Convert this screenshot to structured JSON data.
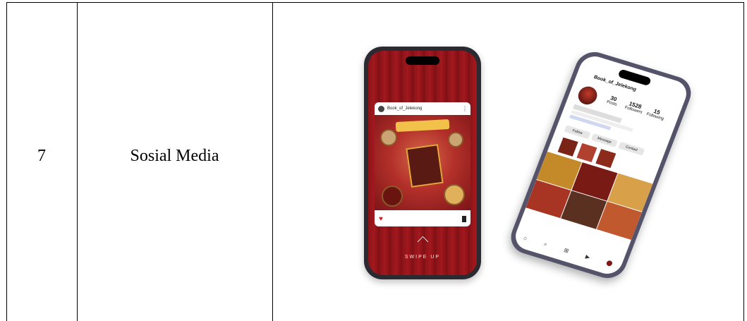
{
  "row": {
    "number": "7",
    "label": "Sosial Media"
  },
  "post": {
    "username": "Book_of_Jelekong",
    "swipe_label": "SWIPE UP"
  },
  "profile": {
    "username": "Book_of_Jelekong",
    "stats": [
      {
        "value": "30",
        "label": "Posts"
      },
      {
        "value": "1528",
        "label": "Followers"
      },
      {
        "value": "15",
        "label": "Following"
      }
    ],
    "buttons": [
      "Follow",
      "Message",
      "Contact"
    ]
  },
  "colors": {
    "curtain": "#8a1418",
    "post_gold": "#f2c14a",
    "phone_frame_front": "#2a2a30",
    "phone_frame_back": "#55536a"
  }
}
